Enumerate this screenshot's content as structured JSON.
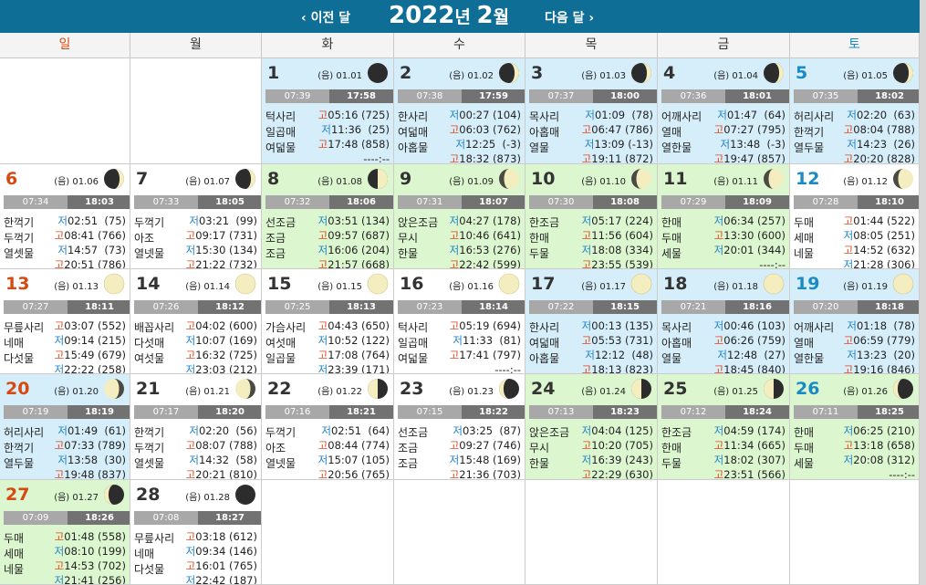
{
  "header": {
    "prev": "‹ 이전 달",
    "year": "2022",
    "year_suffix": "년 ",
    "month": "2",
    "month_suffix": "월",
    "next": "다음 달 ›"
  },
  "weekdays": [
    "일",
    "월",
    "화",
    "수",
    "목",
    "금",
    "토"
  ],
  "colors": {
    "header_bg": "#0f6e96",
    "sunday": "#d64a12",
    "saturday": "#1a8ac6",
    "high_tide": "#e0461c",
    "low_tide": "#2281c4",
    "blue_cell": "#d5eefa",
    "green_cell": "#dcf7cf"
  },
  "days": [
    {
      "d": "1",
      "col": 2,
      "row": 0,
      "bg": "blue",
      "lunar": "(음) 01.01",
      "phase": "new",
      "sr": "07:39",
      "ss": "17:58",
      "mul": [
        "턱사리",
        "일곱매",
        "여덟물"
      ],
      "tides": [
        [
          "고",
          "05:16 (725)"
        ],
        [
          "저",
          "11:36  (25)"
        ],
        [
          "고",
          "17:48 (858)"
        ],
        [
          "",
          "----:--"
        ]
      ]
    },
    {
      "d": "2",
      "col": 3,
      "row": 0,
      "bg": "blue",
      "lunar": "(음) 01.02",
      "phase": "wax_cres",
      "sr": "07:38",
      "ss": "17:59",
      "mul": [
        "한사리",
        "여덟매",
        "아홉물"
      ],
      "tides": [
        [
          "저",
          "00:27 (104)"
        ],
        [
          "고",
          "06:03 (762)"
        ],
        [
          "저",
          "12:25  (-3)"
        ],
        [
          "고",
          "18:32 (873)"
        ]
      ]
    },
    {
      "d": "3",
      "col": 4,
      "row": 0,
      "bg": "blue",
      "lunar": "(음) 01.03",
      "phase": "wax_cres",
      "sr": "07:37",
      "ss": "18:00",
      "mul": [
        "목사리",
        "아홉매",
        "열물"
      ],
      "tides": [
        [
          "저",
          "01:09  (78)"
        ],
        [
          "고",
          "06:47 (786)"
        ],
        [
          "저",
          "13:09 (-13)"
        ],
        [
          "고",
          "19:11 (872)"
        ]
      ]
    },
    {
      "d": "4",
      "col": 5,
      "row": 0,
      "bg": "blue",
      "lunar": "(음) 01.04",
      "phase": "wax_cres",
      "sr": "07:36",
      "ss": "18:01",
      "mul": [
        "어깨사리",
        "열매",
        "열한물"
      ],
      "tides": [
        [
          "저",
          "01:47  (64)"
        ],
        [
          "고",
          "07:27 (795)"
        ],
        [
          "저",
          "13:48  (-3)"
        ],
        [
          "고",
          "19:47 (857)"
        ]
      ]
    },
    {
      "d": "5",
      "col": 6,
      "row": 0,
      "bg": "blue",
      "lunar": "(음) 01.05",
      "phase": "wax_cres",
      "sr": "07:35",
      "ss": "18:02",
      "mul": [
        "허리사리",
        "한꺽기",
        "열두물"
      ],
      "tides": [
        [
          "저",
          "02:20  (63)"
        ],
        [
          "고",
          "08:04 (788)"
        ],
        [
          "저",
          "14:23  (26)"
        ],
        [
          "고",
          "20:20 (828)"
        ]
      ]
    },
    {
      "d": "6",
      "col": 0,
      "row": 1,
      "bg": "white",
      "lunar": "(음) 01.06",
      "phase": "wax_cres",
      "sr": "07:34",
      "ss": "18:03",
      "mul": [
        "한꺽기",
        "두꺽기",
        "열셋물"
      ],
      "tides": [
        [
          "저",
          "02:51  (75)"
        ],
        [
          "고",
          "08:41 (766)"
        ],
        [
          "저",
          "14:57  (73)"
        ],
        [
          "고",
          "20:51 (786)"
        ]
      ]
    },
    {
      "d": "7",
      "col": 1,
      "row": 1,
      "bg": "white",
      "lunar": "(음) 01.07",
      "phase": "wax_cres",
      "sr": "07:33",
      "ss": "18:05",
      "mul": [
        "두꺽기",
        "아조",
        "열넷물"
      ],
      "tides": [
        [
          "저",
          "03:21  (99)"
        ],
        [
          "고",
          "09:17 (731)"
        ],
        [
          "저",
          "15:30 (134)"
        ],
        [
          "고",
          "21:22 (732)"
        ]
      ]
    },
    {
      "d": "8",
      "col": 2,
      "row": 1,
      "bg": "green",
      "lunar": "(음) 01.08",
      "phase": "first_q",
      "sr": "07:32",
      "ss": "18:06",
      "mul": [
        "선조금",
        "조금",
        "조금"
      ],
      "tides": [
        [
          "저",
          "03:51 (134)"
        ],
        [
          "고",
          "09:57 (687)"
        ],
        [
          "저",
          "16:06 (204)"
        ],
        [
          "고",
          "21:57 (668)"
        ]
      ]
    },
    {
      "d": "9",
      "col": 3,
      "row": 1,
      "bg": "green",
      "lunar": "(음) 01.09",
      "phase": "wax_gib",
      "sr": "07:31",
      "ss": "18:07",
      "mul": [
        "앉은조금",
        "무시",
        "한물"
      ],
      "tides": [
        [
          "저",
          "04:27 (178)"
        ],
        [
          "고",
          "10:46 (641)"
        ],
        [
          "저",
          "16:53 (276)"
        ],
        [
          "고",
          "22:42 (599)"
        ]
      ]
    },
    {
      "d": "10",
      "col": 4,
      "row": 1,
      "bg": "green",
      "lunar": "(음) 01.10",
      "phase": "wax_gib",
      "sr": "07:30",
      "ss": "18:08",
      "mul": [
        "한조금",
        "한매",
        "두물"
      ],
      "tides": [
        [
          "저",
          "05:17 (224)"
        ],
        [
          "고",
          "11:56 (604)"
        ],
        [
          "저",
          "18:08 (334)"
        ],
        [
          "고",
          "23:55 (539)"
        ]
      ]
    },
    {
      "d": "11",
      "col": 5,
      "row": 1,
      "bg": "green",
      "lunar": "(음) 01.11",
      "phase": "wax_gib",
      "sr": "07:29",
      "ss": "18:09",
      "mul": [
        "한매",
        "두매",
        "세물"
      ],
      "tides": [
        [
          "저",
          "06:34 (257)"
        ],
        [
          "고",
          "13:30 (600)"
        ],
        [
          "저",
          "20:01 (344)"
        ],
        [
          "",
          "----:--"
        ]
      ]
    },
    {
      "d": "12",
      "col": 6,
      "row": 1,
      "bg": "white",
      "lunar": "(음) 01.12",
      "phase": "wax_gib",
      "sr": "07:28",
      "ss": "18:10",
      "mul": [
        "두매",
        "세매",
        "네물"
      ],
      "tides": [
        [
          "고",
          "01:44 (522)"
        ],
        [
          "저",
          "08:05 (251)"
        ],
        [
          "고",
          "14:52 (632)"
        ],
        [
          "저",
          "21:28 (306)"
        ]
      ]
    },
    {
      "d": "13",
      "col": 0,
      "row": 2,
      "bg": "white",
      "lunar": "(음) 01.13",
      "phase": "full",
      "sr": "07:27",
      "ss": "18:11",
      "mul": [
        "무릎사리",
        "네매",
        "다섯물"
      ],
      "tides": [
        [
          "고",
          "03:07 (552)"
        ],
        [
          "저",
          "09:14 (215)"
        ],
        [
          "고",
          "15:49 (679)"
        ],
        [
          "저",
          "22:22 (258)"
        ]
      ]
    },
    {
      "d": "14",
      "col": 1,
      "row": 2,
      "bg": "white",
      "lunar": "(음) 01.14",
      "phase": "full",
      "sr": "07:26",
      "ss": "18:12",
      "mul": [
        "배꼽사리",
        "다섯매",
        "여섯물"
      ],
      "tides": [
        [
          "고",
          "04:02 (600)"
        ],
        [
          "저",
          "10:07 (169)"
        ],
        [
          "고",
          "16:32 (725)"
        ],
        [
          "저",
          "23:03 (212)"
        ]
      ]
    },
    {
      "d": "15",
      "col": 2,
      "row": 2,
      "bg": "white",
      "lunar": "(음) 01.15",
      "phase": "full",
      "sr": "07:25",
      "ss": "18:13",
      "mul": [
        "가슴사리",
        "여섯매",
        "일곱물"
      ],
      "tides": [
        [
          "고",
          "04:43 (650)"
        ],
        [
          "저",
          "10:52 (122)"
        ],
        [
          "고",
          "17:08 (764)"
        ],
        [
          "저",
          "23:39 (171)"
        ]
      ]
    },
    {
      "d": "16",
      "col": 3,
      "row": 2,
      "bg": "white",
      "lunar": "(음) 01.16",
      "phase": "full",
      "sr": "07:23",
      "ss": "18:14",
      "mul": [
        "턱사리",
        "일곱매",
        "여덟물"
      ],
      "tides": [
        [
          "고",
          "05:19 (694)"
        ],
        [
          "저",
          "11:33  (81)"
        ],
        [
          "고",
          "17:41 (797)"
        ],
        [
          "",
          "----:--"
        ]
      ]
    },
    {
      "d": "17",
      "col": 4,
      "row": 2,
      "bg": "blue",
      "lunar": "(음) 01.17",
      "phase": "full",
      "sr": "07:22",
      "ss": "18:15",
      "mul": [
        "한사리",
        "여덟매",
        "아홉물"
      ],
      "tides": [
        [
          "저",
          "00:13 (135)"
        ],
        [
          "고",
          "05:53 (731)"
        ],
        [
          "저",
          "12:12  (48)"
        ],
        [
          "고",
          "18:13 (823)"
        ]
      ]
    },
    {
      "d": "18",
      "col": 5,
      "row": 2,
      "bg": "blue",
      "lunar": "(음) 01.18",
      "phase": "full",
      "sr": "07:21",
      "ss": "18:16",
      "mul": [
        "목사리",
        "아홉매",
        "열물"
      ],
      "tides": [
        [
          "저",
          "00:46 (103)"
        ],
        [
          "고",
          "06:26 (759)"
        ],
        [
          "저",
          "12:48  (27)"
        ],
        [
          "고",
          "18:45 (840)"
        ]
      ]
    },
    {
      "d": "19",
      "col": 6,
      "row": 2,
      "bg": "blue",
      "lunar": "(음) 01.19",
      "phase": "full",
      "sr": "07:20",
      "ss": "18:18",
      "mul": [
        "어깨사리",
        "열매",
        "열한물"
      ],
      "tides": [
        [
          "저",
          "01:18  (78)"
        ],
        [
          "고",
          "06:59 (779)"
        ],
        [
          "저",
          "13:23  (20)"
        ],
        [
          "고",
          "19:16 (846)"
        ]
      ]
    },
    {
      "d": "20",
      "col": 0,
      "row": 3,
      "bg": "blue",
      "lunar": "(음) 01.20",
      "phase": "wan_gib",
      "sr": "07:19",
      "ss": "18:19",
      "mul": [
        "허리사리",
        "한꺽기",
        "열두물"
      ],
      "tides": [
        [
          "저",
          "01:49  (61)"
        ],
        [
          "고",
          "07:33 (789)"
        ],
        [
          "저",
          "13:58  (30)"
        ],
        [
          "고",
          "19:48 (837)"
        ]
      ]
    },
    {
      "d": "21",
      "col": 1,
      "row": 3,
      "bg": "white",
      "lunar": "(음) 01.21",
      "phase": "wan_gib",
      "sr": "07:17",
      "ss": "18:20",
      "mul": [
        "한꺽기",
        "두꺽기",
        "열셋물"
      ],
      "tides": [
        [
          "저",
          "02:20  (56)"
        ],
        [
          "고",
          "08:07 (788)"
        ],
        [
          "저",
          "14:32  (58)"
        ],
        [
          "고",
          "20:21 (810)"
        ]
      ]
    },
    {
      "d": "22",
      "col": 2,
      "row": 3,
      "bg": "white",
      "lunar": "(음) 01.22",
      "phase": "last_q",
      "sr": "07:16",
      "ss": "18:21",
      "mul": [
        "두꺽기",
        "아조",
        "열넷물"
      ],
      "tides": [
        [
          "저",
          "02:51  (64)"
        ],
        [
          "고",
          "08:44 (774)"
        ],
        [
          "저",
          "15:07 (105)"
        ],
        [
          "고",
          "20:56 (765)"
        ]
      ]
    },
    {
      "d": "23",
      "col": 3,
      "row": 3,
      "bg": "white",
      "lunar": "(음) 01.23",
      "phase": "wan_cres",
      "sr": "07:15",
      "ss": "18:22",
      "mul": [
        "선조금",
        "조금",
        "조금"
      ],
      "tides": [
        [
          "저",
          "03:25  (87)"
        ],
        [
          "고",
          "09:27 (746)"
        ],
        [
          "저",
          "15:48 (169)"
        ],
        [
          "고",
          "21:36 (703)"
        ]
      ]
    },
    {
      "d": "24",
      "col": 4,
      "row": 3,
      "bg": "green",
      "lunar": "(음) 01.24",
      "phase": "last_q",
      "sr": "07:13",
      "ss": "18:23",
      "mul": [
        "앉은조금",
        "무시",
        "한물"
      ],
      "tides": [
        [
          "저",
          "04:04 (125)"
        ],
        [
          "고",
          "10:20 (705)"
        ],
        [
          "저",
          "16:39 (243)"
        ],
        [
          "고",
          "22:29 (630)"
        ]
      ]
    },
    {
      "d": "25",
      "col": 5,
      "row": 3,
      "bg": "green",
      "lunar": "(음) 01.25",
      "phase": "last_q",
      "sr": "07:12",
      "ss": "18:24",
      "mul": [
        "한조금",
        "한매",
        "두물"
      ],
      "tides": [
        [
          "저",
          "04:59 (174)"
        ],
        [
          "고",
          "11:34 (665)"
        ],
        [
          "저",
          "18:02 (307)"
        ],
        [
          "고",
          "23:51 (566)"
        ]
      ]
    },
    {
      "d": "26",
      "col": 6,
      "row": 3,
      "bg": "green",
      "lunar": "(음) 01.26",
      "phase": "wan_cres",
      "sr": "07:11",
      "ss": "18:25",
      "mul": [
        "한매",
        "두매",
        "세물"
      ],
      "tides": [
        [
          "저",
          "06:25 (210)"
        ],
        [
          "고",
          "13:18 (658)"
        ],
        [
          "저",
          "20:08 (312)"
        ],
        [
          "",
          "----:--"
        ]
      ]
    },
    {
      "d": "27",
      "col": 0,
      "row": 4,
      "bg": "green",
      "lunar": "(음) 01.27",
      "phase": "wan_cres",
      "sr": "07:09",
      "ss": "18:26",
      "mul": [
        "두매",
        "세매",
        "네물"
      ],
      "tides": [
        [
          "고",
          "01:48 (558)"
        ],
        [
          "저",
          "08:10 (199)"
        ],
        [
          "고",
          "14:53 (702)"
        ],
        [
          "저",
          "21:41 (256)"
        ]
      ]
    },
    {
      "d": "28",
      "col": 1,
      "row": 4,
      "bg": "white",
      "lunar": "(음) 01.28",
      "phase": "new",
      "sr": "07:08",
      "ss": "18:27",
      "mul": [
        "무릎사리",
        "네매",
        "다섯물"
      ],
      "tides": [
        [
          "고",
          "03:18 (612)"
        ],
        [
          "저",
          "09:34 (146)"
        ],
        [
          "고",
          "16:01 (765)"
        ],
        [
          "저",
          "22:42 (187)"
        ]
      ]
    }
  ]
}
